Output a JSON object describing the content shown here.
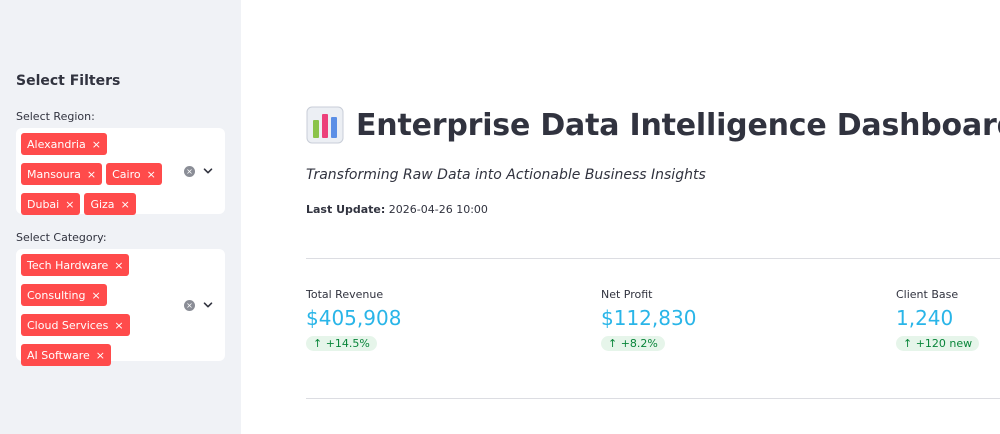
{
  "sidebar": {
    "title": "Select Filters",
    "region_filter": {
      "label": "Select Region:",
      "selected": [
        "Alexandria",
        "Mansoura",
        "Cairo",
        "Dubai",
        "Giza"
      ]
    },
    "category_filter": {
      "label": "Select Category:",
      "selected": [
        "Tech Hardware",
        "Consulting",
        "Cloud Services",
        "AI Software"
      ]
    },
    "remove_glyph": "×",
    "clear_glyph": "×"
  },
  "header": {
    "title": "Enterprise Data Intelligence Dashboard",
    "subtitle": "Transforming Raw Data into Actionable Business Insights",
    "last_update_label": "Last Update:",
    "last_update_value": "2026-04-26 10:00"
  },
  "metrics": [
    {
      "label": "Total Revenue",
      "value": "$405,908",
      "delta": "↑ +14.5%"
    },
    {
      "label": "Net Profit",
      "value": "$112,830",
      "delta": "↑ +8.2%"
    },
    {
      "label": "Client Base",
      "value": "1,240",
      "delta": "↑ +120 new"
    }
  ],
  "colors": {
    "accent": "#ff4b4b",
    "metric_value": "#29b5e8",
    "delta_positive": "#09853a",
    "sidebar_bg": "#f0f2f6"
  },
  "icons": {
    "title_icon": "bar-chart-icon",
    "anchor_icon": "link-icon",
    "dropdown_icon": "chevron-down-icon",
    "clear_icon": "clear-icon"
  }
}
